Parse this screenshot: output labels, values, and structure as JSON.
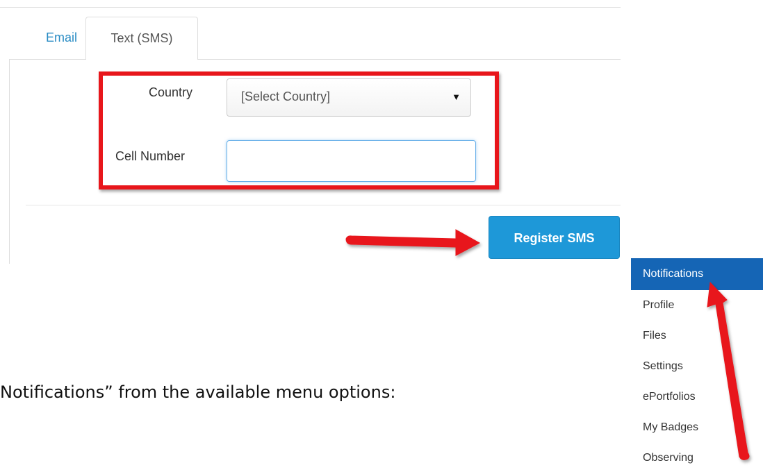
{
  "tabs": [
    {
      "label": "Email",
      "active": false
    },
    {
      "label": "Text (SMS)",
      "active": true
    }
  ],
  "form": {
    "country_label": "Country",
    "country_selected": "[Select Country]",
    "cell_label": "Cell Number",
    "cell_value": "",
    "register_label": "Register SMS"
  },
  "menu": {
    "items": [
      {
        "label": "Notifications",
        "active": true
      },
      {
        "label": "Profile"
      },
      {
        "label": "Files"
      },
      {
        "label": "Settings"
      },
      {
        "label": "ePortfolios"
      },
      {
        "label": "My Badges"
      },
      {
        "label": "Observing"
      }
    ]
  },
  "caption": "Notifications” from the available menu options:",
  "colors": {
    "accent_link": "#2a8cc4",
    "primary_button": "#1e98d8",
    "menu_active": "#1565b5",
    "annotation_red": "#e8161b"
  }
}
